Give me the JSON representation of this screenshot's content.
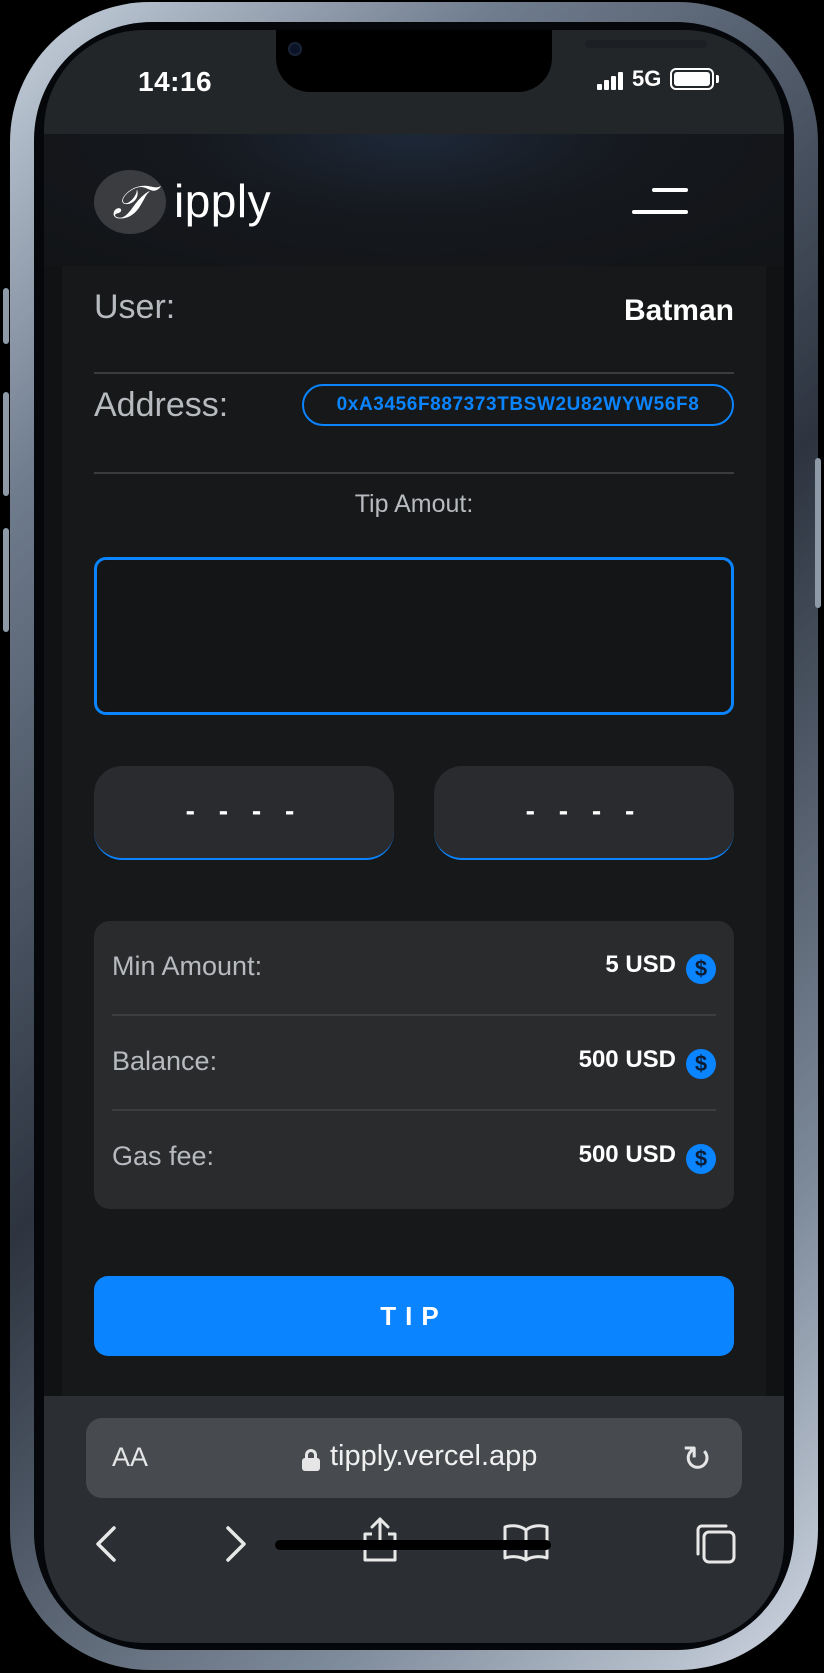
{
  "status_bar": {
    "time": "14:16",
    "network": "5G",
    "battery_level": 1.0
  },
  "header": {
    "logo_letter": "𝒯",
    "app_name": "ipply",
    "menu_icon": "hamburger-menu-icon"
  },
  "profile": {
    "user_label": "User:",
    "user_value": "Batman",
    "address_label": "Address:",
    "address_value": "0xA3456F887373TBSW2U82WYW56F8"
  },
  "tip": {
    "label": "Tip Amout:",
    "input_value": "",
    "preset_1": "- - - -",
    "preset_2": "- - - -"
  },
  "info": {
    "min_amount_label": "Min Amount:",
    "min_amount_value": "5 USD",
    "balance_label": "Balance:",
    "balance_value": "500 USD",
    "gas_fee_label": "Gas fee:",
    "gas_fee_value": "500 USD",
    "currency_icon": "dollar-coin-icon",
    "currency_glyph": "$"
  },
  "actions": {
    "tip_button": "TIP"
  },
  "browser": {
    "aa_label": "AA",
    "url": "tipply.vercel.app",
    "reload_glyph": "↻",
    "back_glyph": "‹",
    "forward_glyph": "›"
  },
  "colors": {
    "accent": "#0a84ff",
    "background": "#171819",
    "card": "#2a2b2d"
  }
}
